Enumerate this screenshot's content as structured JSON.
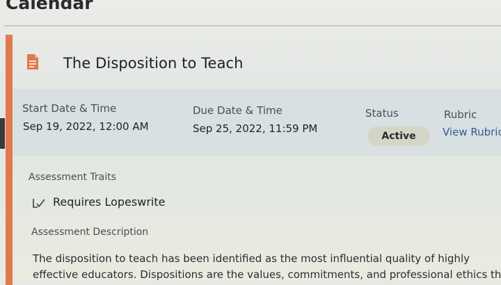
{
  "header": {
    "title": "Calendar"
  },
  "assignment": {
    "title": "The Disposition to Teach",
    "start": {
      "label": "Start Date & Time",
      "value": "Sep 19, 2022, 12:00 AM"
    },
    "due": {
      "label": "Due Date & Time",
      "value": "Sep 25, 2022, 11:59 PM"
    },
    "status": {
      "label": "Status",
      "value": "Active"
    },
    "rubric": {
      "label": "Rubric",
      "link": "View Rubric"
    }
  },
  "traits": {
    "label": "Assessment Traits",
    "items": [
      "Requires Lopeswrite"
    ]
  },
  "description": {
    "label": "Assessment Description",
    "lines": [
      "The disposition to teach has been identified as the most influential quality of highly",
      "effective educators. Dispositions are the values, commitments, and professional ethics that"
    ]
  },
  "colors": {
    "accent": "#e0794d",
    "link": "#2b5e93",
    "status_badge": "#d3d6c6"
  },
  "icons": {
    "assignment": "document-icon",
    "trait": "checkmark-icon"
  }
}
